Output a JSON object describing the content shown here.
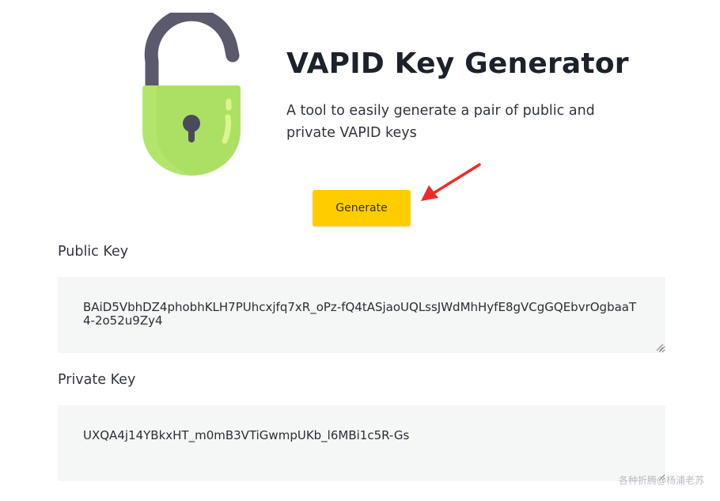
{
  "header": {
    "title": "VAPID Key Generator",
    "subtitle": "A tool to easily generate a pair of public and private VAPID keys",
    "illustration_icon": "unlocked-padlock-icon"
  },
  "actions": {
    "generate_label": "Generate"
  },
  "fields": {
    "public_key": {
      "label": "Public Key",
      "value": "BAiD5VbhDZ4phobhKLH7PUhcxjfq7xR_oPz-fQ4tASjaoUQLssJWdMhHyfE8gVCgGQEbvrOgbaaT4-2o52u9Zy4"
    },
    "private_key": {
      "label": "Private Key",
      "value": "UXQA4j14YBkxHT_m0mB3VTiGwmpUKb_l6MBi1c5R-Gs"
    }
  },
  "annotation": {
    "icon": "red-arrow-icon",
    "color": "#ee2b2b"
  },
  "watermark": {
    "text": "各种折腾@杨浦老苏"
  },
  "colors": {
    "accent": "#ffcc00",
    "lock_body": "#b3e56d",
    "lock_shackle": "#5b5a6d",
    "field_bg": "#f5f6f6"
  }
}
